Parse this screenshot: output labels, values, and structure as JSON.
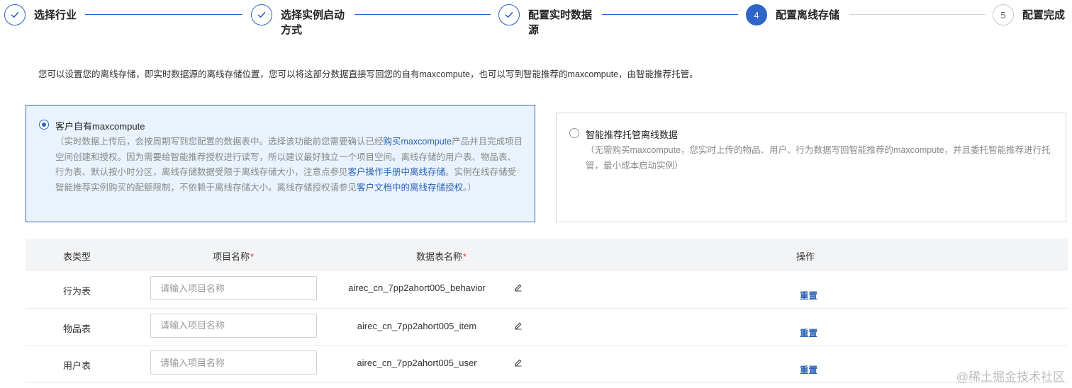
{
  "steps": [
    {
      "title": "选择行业",
      "status": "done"
    },
    {
      "title_line1": "选择实例启动",
      "title_line2": "方式",
      "status": "done"
    },
    {
      "title_line1": "配置实时数据",
      "title_line2": "源",
      "status": "done"
    },
    {
      "number": "4",
      "title": "配置离线存储",
      "status": "active"
    },
    {
      "number": "5",
      "title": "配置完成",
      "status": "pending"
    }
  ],
  "description": "您可以设置您的离线存储，即实时数据源的离线存储位置，您可以将这部分数据直接写回您的自有maxcompute，也可以写到智能推荐的maxcompute，由智能推荐托管。",
  "option_own": {
    "title": "客户自有maxcompute",
    "selected": true,
    "body_part1": "（实时数据上传后，会按周期写到您配置的数据表中。选择该功能前您需要确认已经",
    "link1": "购买maxcompute",
    "body_part2": "产品并且完成项目空间创建和授权。因为需要给智能推荐授权进行读写，所以建议最好独立一个项目空间。离线存储的用户表、物品表、行为表、默认按小时分区，离线存储数据受限于离线存储大小，注意点参见",
    "link2": "客户操作手册中离线存储",
    "body_part3": "。实例在线存储受智能推荐实例购买的配额限制，不依赖于离线存储大小。离线存储授权请参见",
    "link3": "客户文档中的离线存储授权",
    "body_part4": "。）"
  },
  "option_managed": {
    "title": "智能推荐托管离线数据",
    "selected": false,
    "body": "（无需购买maxcompute，您实时上传的物品、用户、行为数据写回智能推荐的maxcompute，并且委托智能推荐进行托管，最小成本启动实例）"
  },
  "table": {
    "headers": {
      "type": "表类型",
      "project": "项目名称",
      "datatable": "数据表名称",
      "action": "操作",
      "required_mark": "*"
    },
    "input_placeholder": "请输入项目名称",
    "rows": [
      {
        "type": "行为表",
        "project_value": "",
        "table_name": "airec_cn_7pp2ahort005_behavior",
        "action": "重置"
      },
      {
        "type": "物品表",
        "project_value": "",
        "table_name": "airec_cn_7pp2ahort005_item",
        "action": "重置"
      },
      {
        "type": "用户表",
        "project_value": "",
        "table_name": "airec_cn_7pp2ahort005_user",
        "action": "重置"
      }
    ]
  },
  "watermark": "@稀土掘金技术社区",
  "colors": {
    "primary": "#2f64c8",
    "link": "#2a61b5",
    "selected_card_bg": "#eaf3fd",
    "required": "#e23c2a",
    "table_header_bg": "#f3f4f6"
  },
  "icons": {
    "step_done": "check-icon",
    "edit": "pencil-icon"
  }
}
